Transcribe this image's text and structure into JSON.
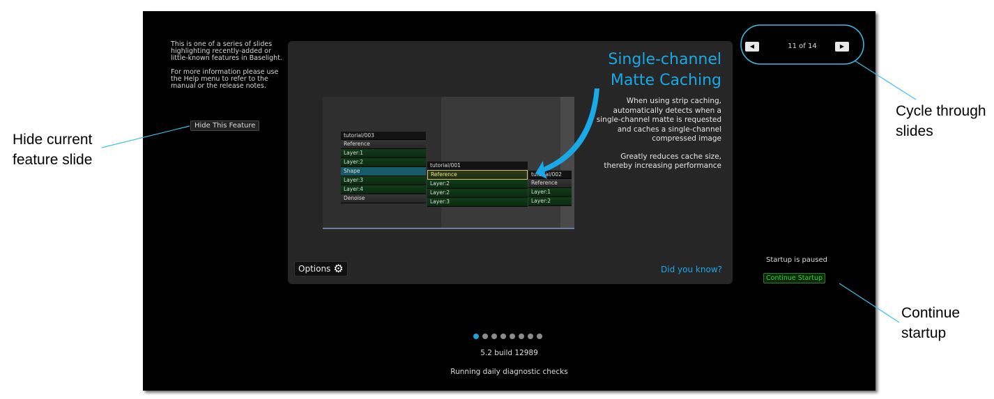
{
  "callouts": {
    "hide_line1": "Hide current",
    "hide_line2": "feature slide",
    "cycle_line1": "Cycle through",
    "cycle_line2": "slides",
    "continue_line1": "Continue",
    "continue_line2": "startup"
  },
  "info": {
    "para1": "This is one of a series of slides highlighting recently-added or little-known features in Baselight.",
    "para2": "For more information please use the Help menu to refer to the manual or the release notes.",
    "hide_button": "Hide This Feature"
  },
  "slide": {
    "title_line1": "Single-channel",
    "title_line2": "Matte Caching",
    "desc1": "When using strip caching, automatically detects when a single-channel matte is requested and caches a single-channel compressed image",
    "desc2": "Greatly reduces cache size, thereby increasing performance",
    "did_you_know": "Did you know?",
    "options_label": "Options",
    "stack1": {
      "header": "tutorial/003",
      "rows": [
        "Reference",
        "Layer:1",
        "Layer:2",
        "Shape",
        "Layer:3",
        "Layer:4",
        "Denoise"
      ]
    },
    "stack2": {
      "header": "tutorial/001",
      "rows": [
        "Reference",
        "Layer:2",
        "Layer:2",
        "Layer:3"
      ]
    },
    "stack3": {
      "header": "tutorial/002",
      "rows": [
        "Reference",
        "Layer:1",
        "Layer:2"
      ]
    }
  },
  "nav": {
    "prev_icon": "triangle-left-icon",
    "next_icon": "triangle-right-icon",
    "count": "11 of 14",
    "current": 11,
    "total": 14
  },
  "startup": {
    "paused": "Startup is paused",
    "continue": "Continue Startup"
  },
  "pagination": {
    "count": 8,
    "active": 0
  },
  "footer": {
    "build": "5.2 build 12989",
    "status": "Running daily diagnostic checks"
  },
  "colors": {
    "accent": "#19a9e6",
    "callout_line": "#3cc0e8",
    "continue_green": "#38d038"
  }
}
